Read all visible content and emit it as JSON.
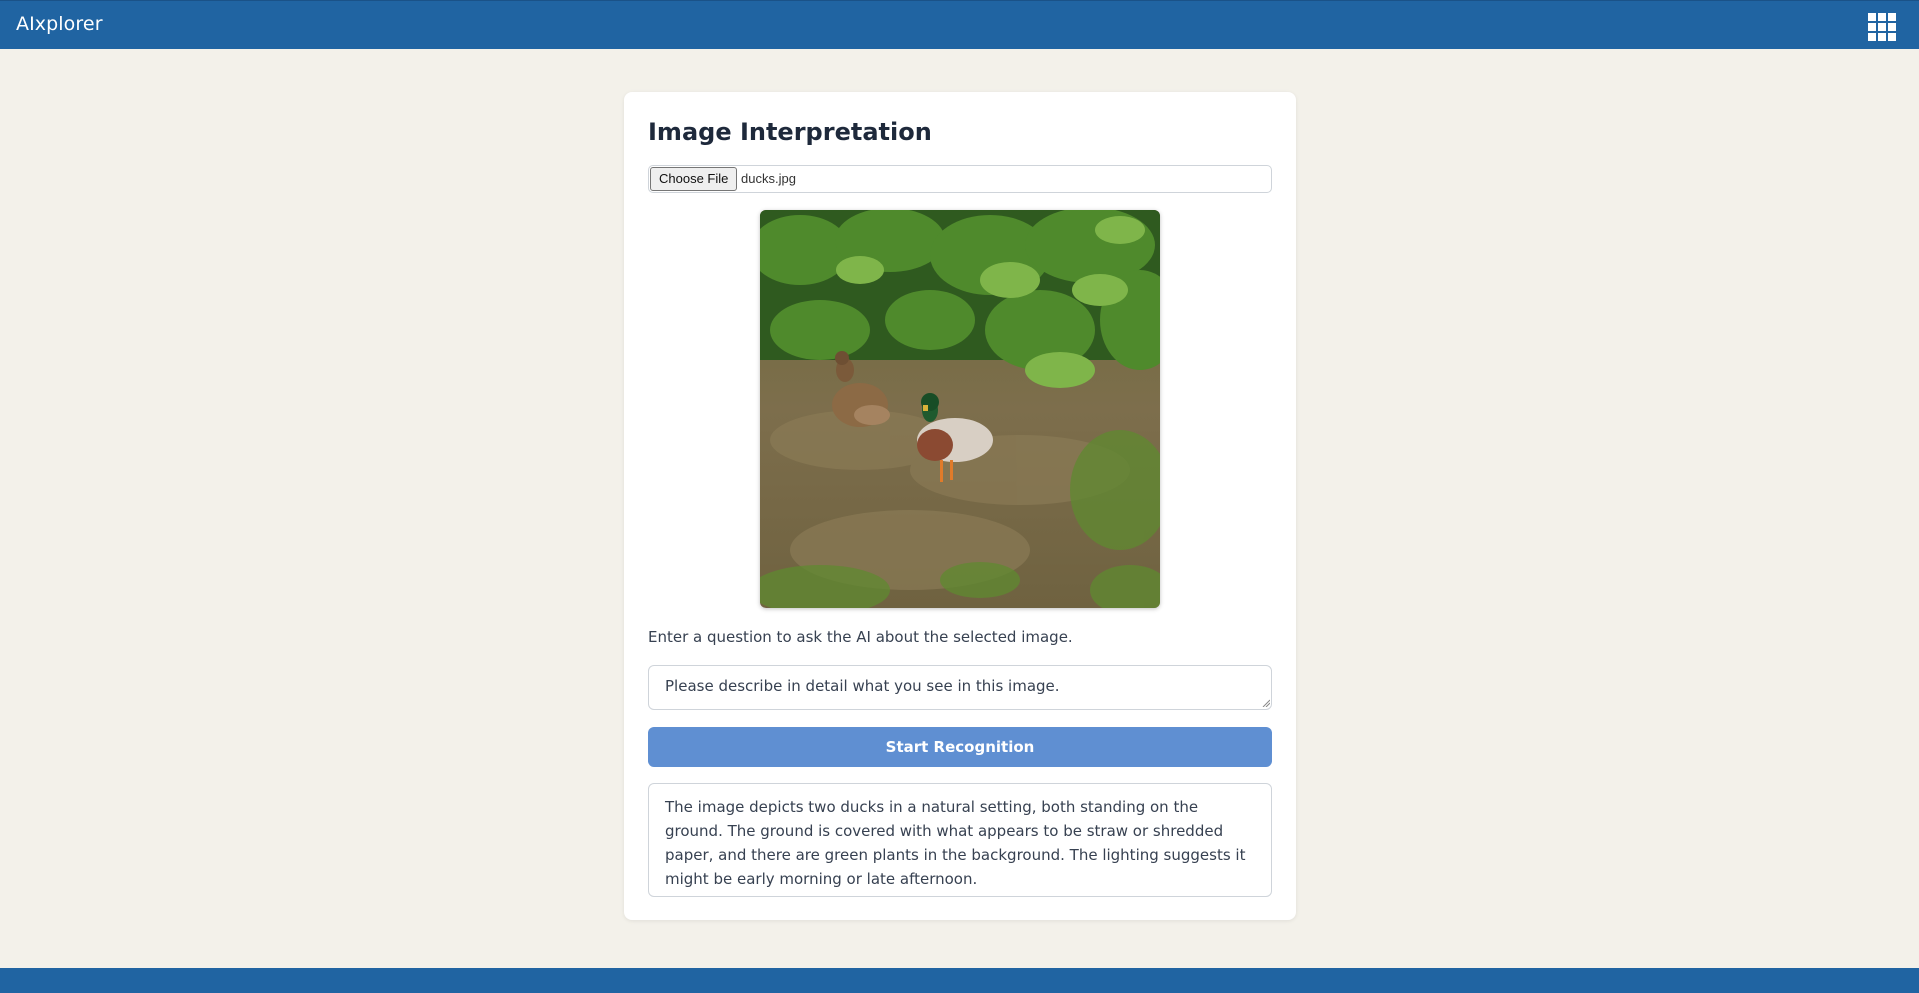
{
  "header": {
    "app_title": "AIxplorer",
    "apps_icon": "grid-apps-icon"
  },
  "card": {
    "title": "Image Interpretation",
    "file_input": {
      "button_label": "Choose File",
      "file_name": "ducks.jpg"
    },
    "preview": {
      "icon": "image-preview"
    },
    "question_label": "Enter a question to ask the AI about the selected image.",
    "question_value": "Please describe in detail what you see in this image.",
    "start_button_label": "Start Recognition",
    "result_text": "The image depicts two ducks in a natural setting, both standing on the ground. The ground is covered with what appears to be straw or shredded paper, and there are green plants in the background. The lighting suggests it might be early morning or late afternoon."
  },
  "colors": {
    "header_bg": "#2064a2",
    "page_bg": "#f3f1ea",
    "button_bg": "#5f8fd2",
    "card_bg": "#ffffff"
  }
}
